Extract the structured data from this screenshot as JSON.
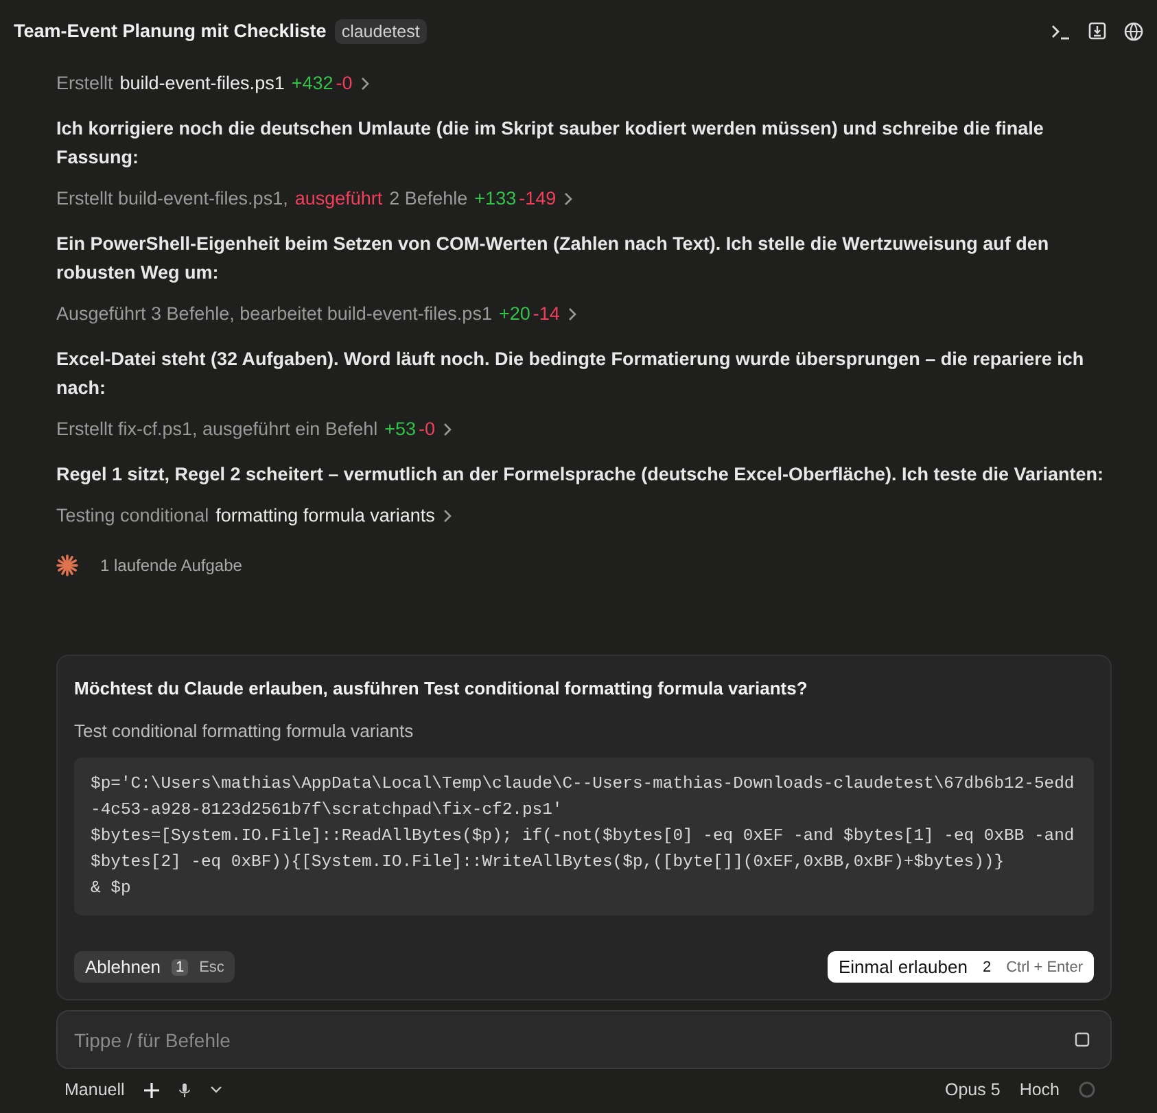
{
  "header": {
    "title": "Team-Event Planung mit Checkliste",
    "badge": "claudetest"
  },
  "messages": [
    {
      "kind": "action",
      "segments": [
        {
          "kind": "muted",
          "text": "Erstellt"
        },
        {
          "kind": "strong",
          "text": "build-event-files.ps1"
        }
      ],
      "added": "+432",
      "removed": "-0"
    },
    {
      "kind": "text",
      "text": "Ich korrigiere noch die deutschen Umlaute (die im Skript sauber kodiert werden müssen) und schreibe die finale Fassung:"
    },
    {
      "kind": "action",
      "segments": [
        {
          "kind": "muted",
          "text": "Erstellt build-event-files.ps1,"
        },
        {
          "kind": "alert",
          "text": "ausgeführt"
        },
        {
          "kind": "muted",
          "text": "2 Befehle"
        }
      ],
      "added": "+133",
      "removed": "-149"
    },
    {
      "kind": "text",
      "text": "Ein PowerShell-Eigenheit beim Setzen von COM-Werten (Zahlen nach Text). Ich stelle die Wertzuweisung auf den robusten Weg um:"
    },
    {
      "kind": "action",
      "segments": [
        {
          "kind": "muted",
          "text": "Ausgeführt 3 Befehle, bearbeitet build-event-files.ps1"
        }
      ],
      "added": "+20",
      "removed": "-14"
    },
    {
      "kind": "text",
      "text": "Excel-Datei steht (32 Aufgaben). Word läuft noch. Die bedingte Formatierung wurde übersprungen – die repariere ich nach:"
    },
    {
      "kind": "action",
      "segments": [
        {
          "kind": "muted",
          "text": "Erstellt fix-cf.ps1, ausgeführt ein Befehl"
        }
      ],
      "added": "+53",
      "removed": "-0"
    },
    {
      "kind": "text",
      "text": "Regel 1 sitzt, Regel 2 scheitert – vermutlich an der Formelsprache (deutsche Excel-Oberfläche). Ich teste die Varianten:"
    },
    {
      "kind": "action",
      "segments": [
        {
          "kind": "muted",
          "text": "Testing conditional"
        },
        {
          "kind": "strong",
          "text": "formatting formula variants"
        }
      ]
    }
  ],
  "running": "1 laufende Aufgabe",
  "permission": {
    "question": "Möchtest du Claude erlauben, ausführen Test conditional formatting formula variants?",
    "description": "Test conditional formatting formula variants",
    "code": [
      "$p='C:\\Users\\mathias\\AppData\\Local\\Temp\\claude\\C--Users-mathias-Downloads-claudetest\\67db6b12-5edd-4c53-a928-8123d2561b7f\\scratchpad\\fix-cf2.ps1'",
      "$bytes=[System.IO.File]::ReadAllBytes($p); if(-not($bytes[0] -eq 0xEF -and $bytes[1] -eq 0xBB -and $bytes[2] -eq 0xBF)){[System.IO.File]::WriteAllBytes($p,([byte[]](0xEF,0xBB,0xBF)+$bytes))}",
      "& $p"
    ],
    "buttons": [
      {
        "kind": "secondary",
        "label": "Ablehnen",
        "key": "1",
        "shortcut": "Esc"
      },
      {
        "kind": "primary",
        "label": "Einmal erlauben",
        "key": "2",
        "shortcut": "Ctrl + Enter"
      }
    ]
  },
  "input": {
    "placeholder": "Tippe / für Befehle"
  },
  "footer": {
    "mode": "Manuell",
    "model": "Opus 5",
    "effort": "Hoch"
  }
}
